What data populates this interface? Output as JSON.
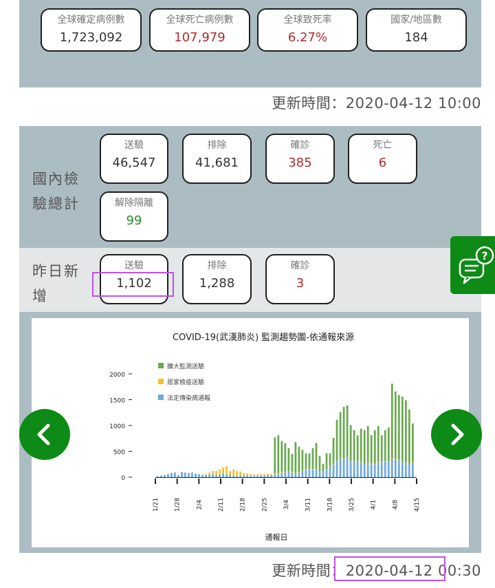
{
  "global": {
    "stats": [
      {
        "label": "全球確定病例數",
        "value": "1,723,092",
        "color": "normal"
      },
      {
        "label": "全球死亡病例數",
        "value": "107,979",
        "color": "red"
      },
      {
        "label": "全球致死率",
        "value": "6.27%",
        "color": "red"
      },
      {
        "label": "國家/地區數",
        "value": "184",
        "color": "normal"
      }
    ],
    "updated": "更新時間：2020-04-12 10:00"
  },
  "domestic": {
    "label_line1": "國內檢",
    "label_line2": "驗總計",
    "stats": [
      {
        "label": "送驗",
        "value": "46,547",
        "color": "normal"
      },
      {
        "label": "排除",
        "value": "41,681",
        "color": "normal"
      },
      {
        "label": "確診",
        "value": "385",
        "color": "red"
      },
      {
        "label": "死亡",
        "value": "6",
        "color": "red"
      },
      {
        "label": "解除隔離",
        "value": "99",
        "color": "green"
      }
    ]
  },
  "yesterday": {
    "label_line1": "昨日新",
    "label_line2": "增",
    "stats": [
      {
        "label": "送驗",
        "value": "1,102",
        "color": "normal"
      },
      {
        "label": "排除",
        "value": "1,288",
        "color": "normal"
      },
      {
        "label": "確診",
        "value": "3",
        "color": "red"
      }
    ]
  },
  "chart_updated": "更新時間：2020-04-12 00:30",
  "icons": {
    "prev": "chevron-left-icon",
    "next": "chevron-right-icon",
    "chat": "chat-help-icon"
  },
  "colors": {
    "panel": "#acbcc3",
    "accent_green": "#0e8a16",
    "red": "#b02a2a",
    "highlight": "#c34ee6",
    "series_green": "#6aa84f",
    "series_yellow": "#f1c232",
    "series_blue": "#6fa8dc"
  },
  "chart_data": {
    "type": "bar",
    "stacked": true,
    "title": "COVID-19(武漢肺炎) 監測趨勢圖-依通報來源",
    "xlabel": "通報日",
    "ylabel": "",
    "ylim": [
      0,
      2000
    ],
    "yticks": [
      "0",
      "500",
      "1000",
      "1500",
      "2000"
    ],
    "xticks": [
      "1/21",
      "1/28",
      "2/4",
      "2/11",
      "2/18",
      "2/25",
      "3/4",
      "3/11",
      "3/18",
      "3/25",
      "4/1",
      "4/8",
      "4/15"
    ],
    "legend": [
      "擴大監測送驗",
      "居家檢疫送驗",
      "法定傳染病通報"
    ],
    "series": [
      {
        "name": "法定傳染病通報",
        "color": "#6fa8dc",
        "values": [
          20,
          30,
          40,
          60,
          80,
          90,
          40,
          100,
          90,
          80,
          90,
          70,
          60,
          50,
          40,
          50,
          60,
          40,
          50,
          70,
          60,
          40,
          30,
          20,
          30,
          20,
          30,
          20,
          20,
          30,
          30,
          30,
          40,
          40,
          50,
          60,
          80,
          100,
          100,
          90,
          70,
          80,
          120,
          150,
          150,
          150,
          150,
          100,
          100,
          150,
          200,
          250,
          300,
          350,
          350,
          380,
          300,
          300,
          300,
          280,
          250,
          280,
          250,
          250,
          280,
          300,
          300,
          300,
          350,
          350,
          330,
          300,
          280,
          250,
          280
        ]
      },
      {
        "name": "居家檢疫送驗",
        "color": "#f1c232",
        "values": [
          0,
          0,
          0,
          0,
          0,
          0,
          0,
          0,
          0,
          0,
          0,
          0,
          0,
          0,
          20,
          40,
          60,
          80,
          100,
          120,
          150,
          80,
          120,
          100,
          80,
          60,
          40,
          40,
          30,
          30,
          30,
          30,
          30,
          20,
          20,
          20,
          20,
          10,
          10,
          10,
          10,
          10,
          10,
          10,
          10,
          10,
          10,
          10,
          10,
          10,
          10,
          10,
          10,
          10,
          10,
          10,
          10,
          10,
          10,
          10,
          10,
          10,
          10,
          10,
          10,
          10,
          10,
          10,
          10,
          10,
          10,
          10,
          10,
          10,
          10
        ]
      },
      {
        "name": "擴大監測送驗",
        "color": "#6aa84f",
        "values": [
          0,
          0,
          0,
          0,
          0,
          0,
          0,
          0,
          0,
          0,
          0,
          0,
          0,
          0,
          0,
          0,
          0,
          0,
          0,
          0,
          0,
          0,
          0,
          0,
          0,
          0,
          0,
          0,
          0,
          0,
          0,
          0,
          0,
          0,
          700,
          730,
          600,
          550,
          450,
          350,
          600,
          500,
          400,
          300,
          300,
          400,
          500,
          300,
          150,
          300,
          250,
          500,
          800,
          900,
          1000,
          1000,
          700,
          600,
          500,
          650,
          650,
          700,
          550,
          650,
          700,
          500,
          600,
          650,
          1450,
          1300,
          1250,
          1250,
          1200,
          1050,
          750
        ]
      }
    ]
  }
}
